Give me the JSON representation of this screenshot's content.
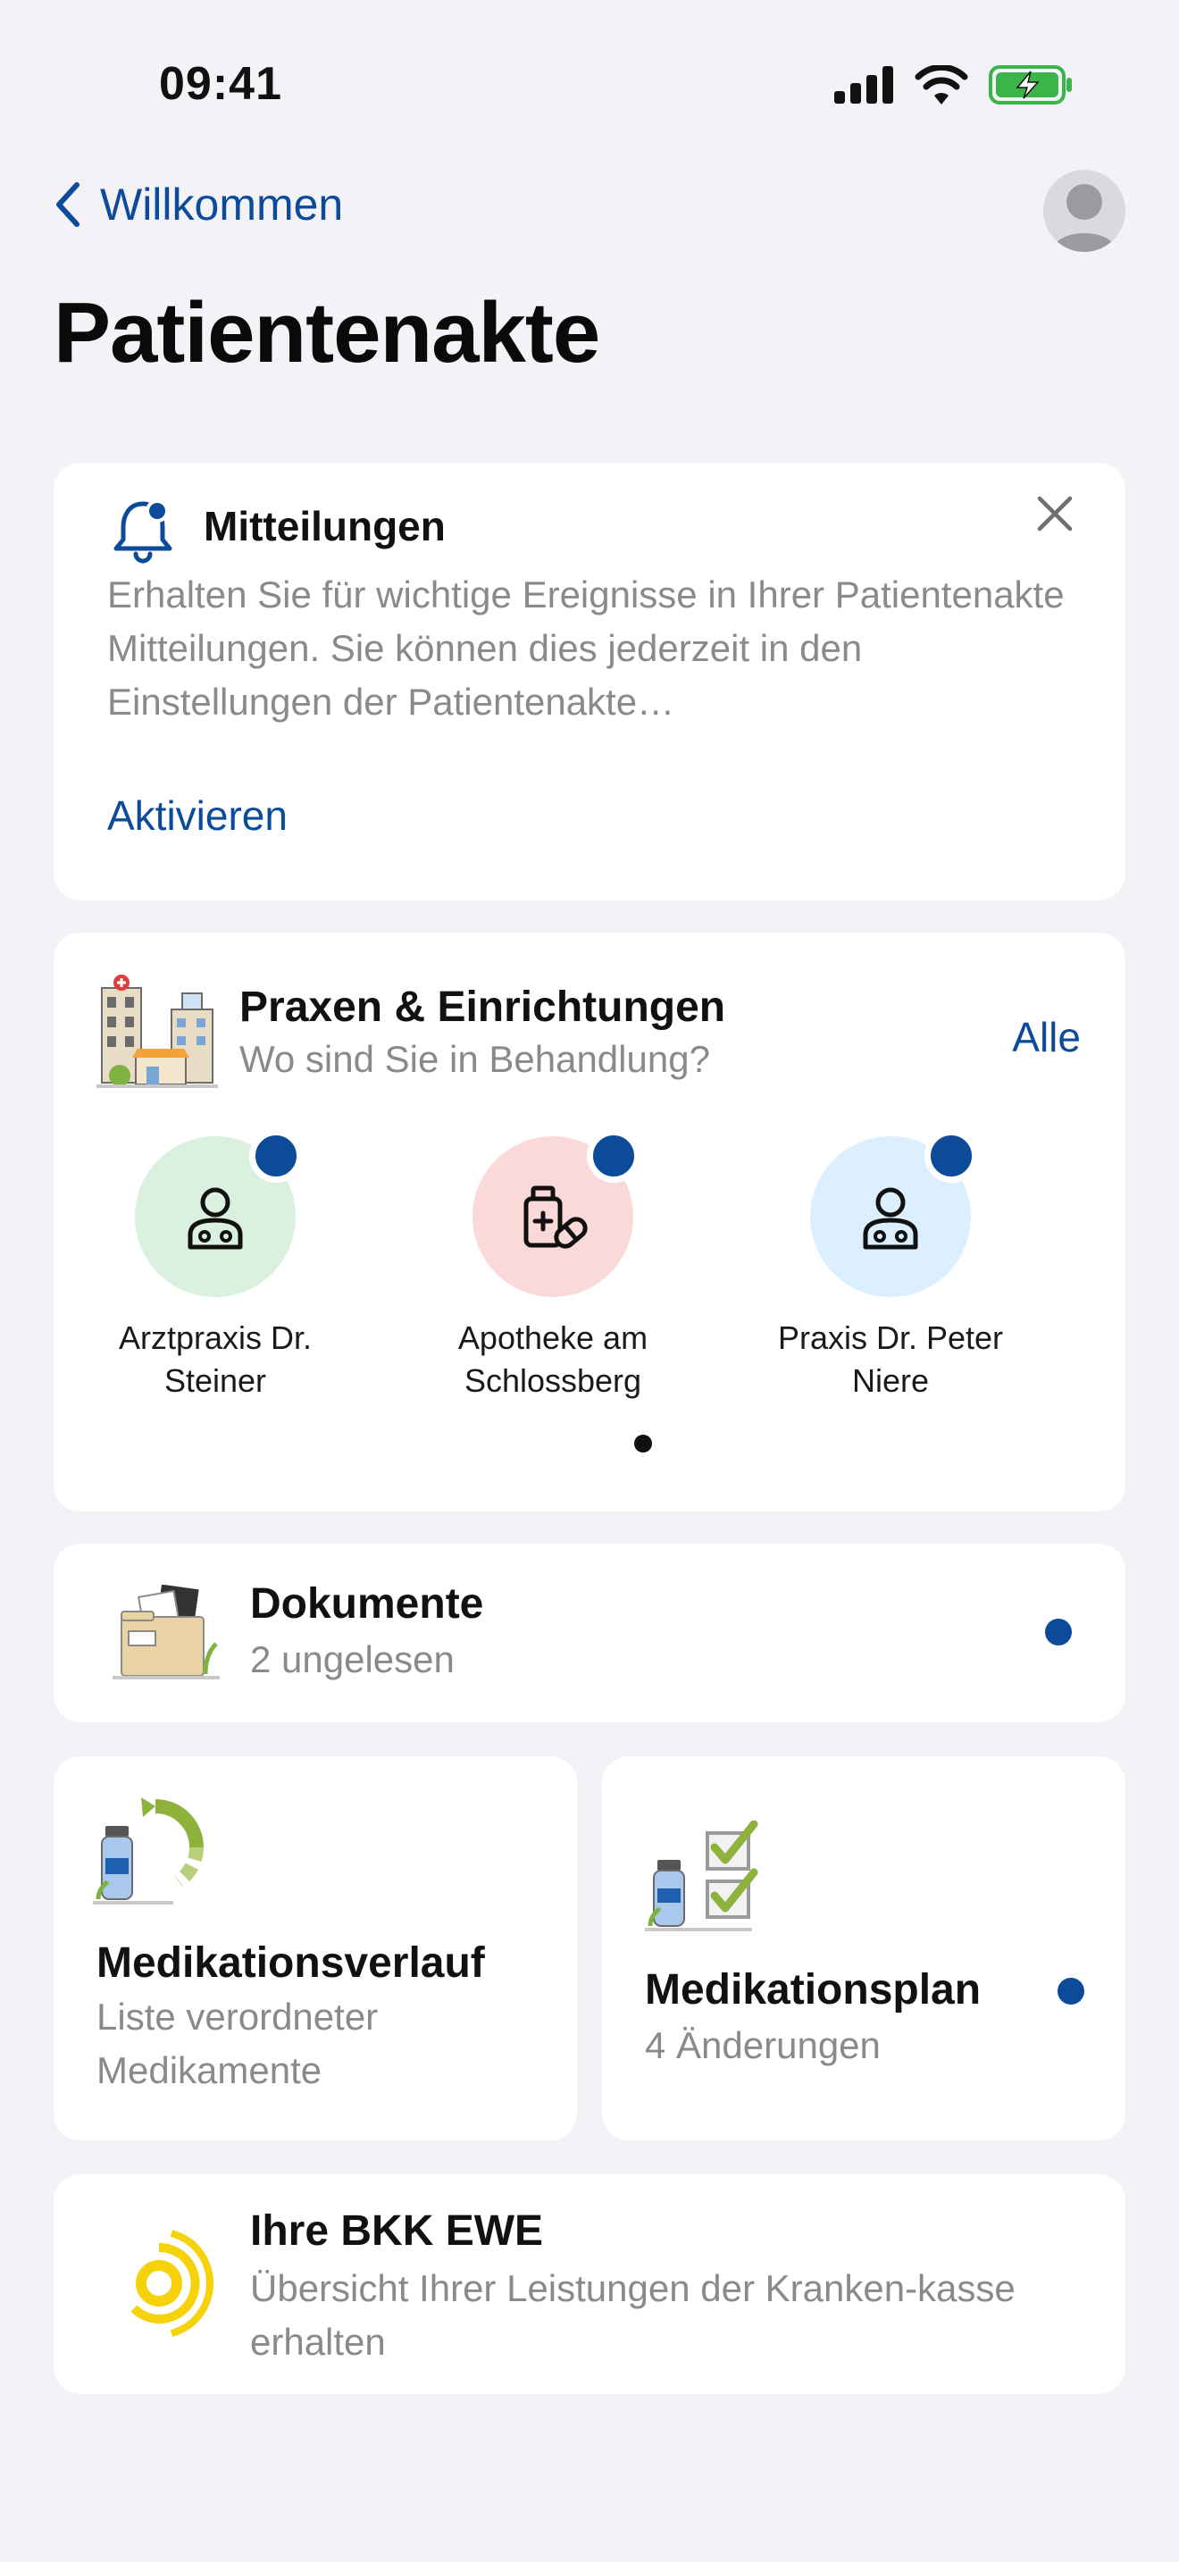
{
  "status_bar": {
    "time": "09:41"
  },
  "nav": {
    "back_label": "Willkommen"
  },
  "page": {
    "title": "Patientenakte"
  },
  "notifications_card": {
    "title": "Mitteilungen",
    "body": "Erhalten Sie für wichtige Ereignisse in Ihrer Patientenakte Mitteilungen. Sie können dies jederzeit in den Einstellungen der Patientenakte…",
    "action_label": "Aktivieren"
  },
  "practices_card": {
    "title": "Praxen & Einrichtungen",
    "subtitle": "Wo sind Sie in Behandlung?",
    "all_label": "Alle",
    "providers": [
      {
        "name": "Arztpraxis Dr. Steiner",
        "icon": "doctor-icon",
        "color": "#d9f1de"
      },
      {
        "name": "Apotheke am Schlossberg",
        "icon": "pharmacy-icon",
        "color": "#fcd9d9"
      },
      {
        "name": "Praxis Dr. Peter Niere",
        "icon": "doctor-icon",
        "color": "#dcefff"
      }
    ]
  },
  "documents_card": {
    "title": "Dokumente",
    "subtitle": "2 ungelesen"
  },
  "medication_history_card": {
    "title": "Medikationsverlauf",
    "subtitle": "Liste verordneter Medikamente"
  },
  "medication_plan_card": {
    "title": "Medikationsplan",
    "subtitle": "4 Änderungen"
  },
  "insurance_card": {
    "title": "Ihre BKK EWE",
    "subtitle": "Übersicht Ihrer Leistungen der Kranken-kasse erhalten"
  },
  "colors": {
    "accent": "#0c4a9a",
    "background": "#f2f2f7",
    "card": "#ffffff",
    "secondary_text": "#8a8a8e",
    "battery": "#3bb54a",
    "bkk_logo": "#f5d20a"
  }
}
